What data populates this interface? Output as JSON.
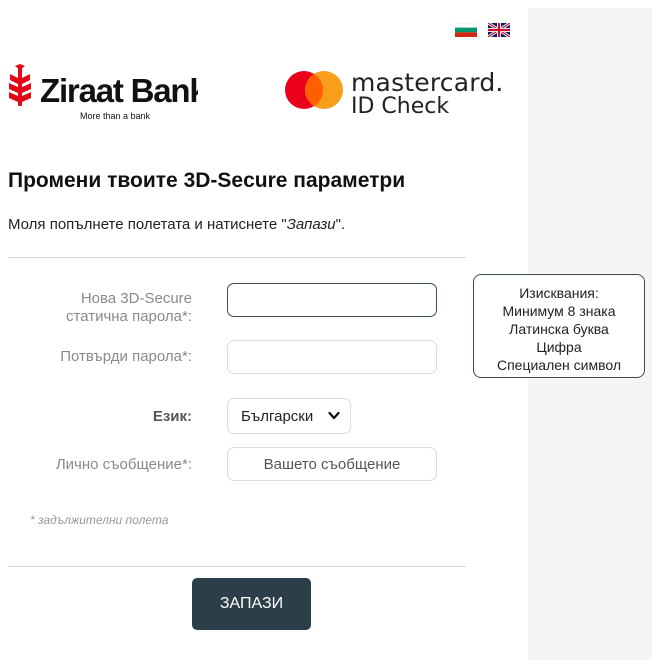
{
  "languages": {
    "flags": [
      {
        "name": "bulgarian-flag-icon",
        "colors": [
          "#ffffff",
          "#00966e",
          "#d62612"
        ]
      },
      {
        "name": "uk-flag-icon",
        "colors": [
          "#012169",
          "#ffffff",
          "#c8102e"
        ]
      }
    ]
  },
  "header": {
    "bank_name": "Ziraat Bank",
    "bank_tagline": "More than a bank",
    "card_brand": "mastercard.",
    "card_program": "ID Check"
  },
  "page": {
    "title": "Промени твоите 3D-Secure параметри",
    "instructions_prefix": "Моля попълнете полетата и натиснете \"",
    "instructions_emphasis": "Запази",
    "instructions_suffix": "\"."
  },
  "form": {
    "new_password_label_line1": "Нова 3D-Secure",
    "new_password_label_line2": "статична парола*:",
    "new_password_value": "",
    "confirm_password_label": "Потвърди парола*:",
    "confirm_password_value": "",
    "language_label": "Език:",
    "language_selected": "Български",
    "message_label": "Лично съобщение*:",
    "message_placeholder": "Вашето съобщение",
    "message_value": "",
    "required_note": "* задължителни полета",
    "save_label": "ЗАПАЗИ"
  },
  "requirements": {
    "title": "Изисквания:",
    "items": [
      "Минимум 8 знака",
      "Латинска буква",
      "Цифра",
      "Специален символ"
    ]
  },
  "colors": {
    "ziraat_red": "#e30a17",
    "mastercard_red": "#eb001b",
    "mastercard_yellow": "#f79e1b",
    "mastercard_overlap": "#ff5f00",
    "button_bg": "#2d3e4b"
  }
}
